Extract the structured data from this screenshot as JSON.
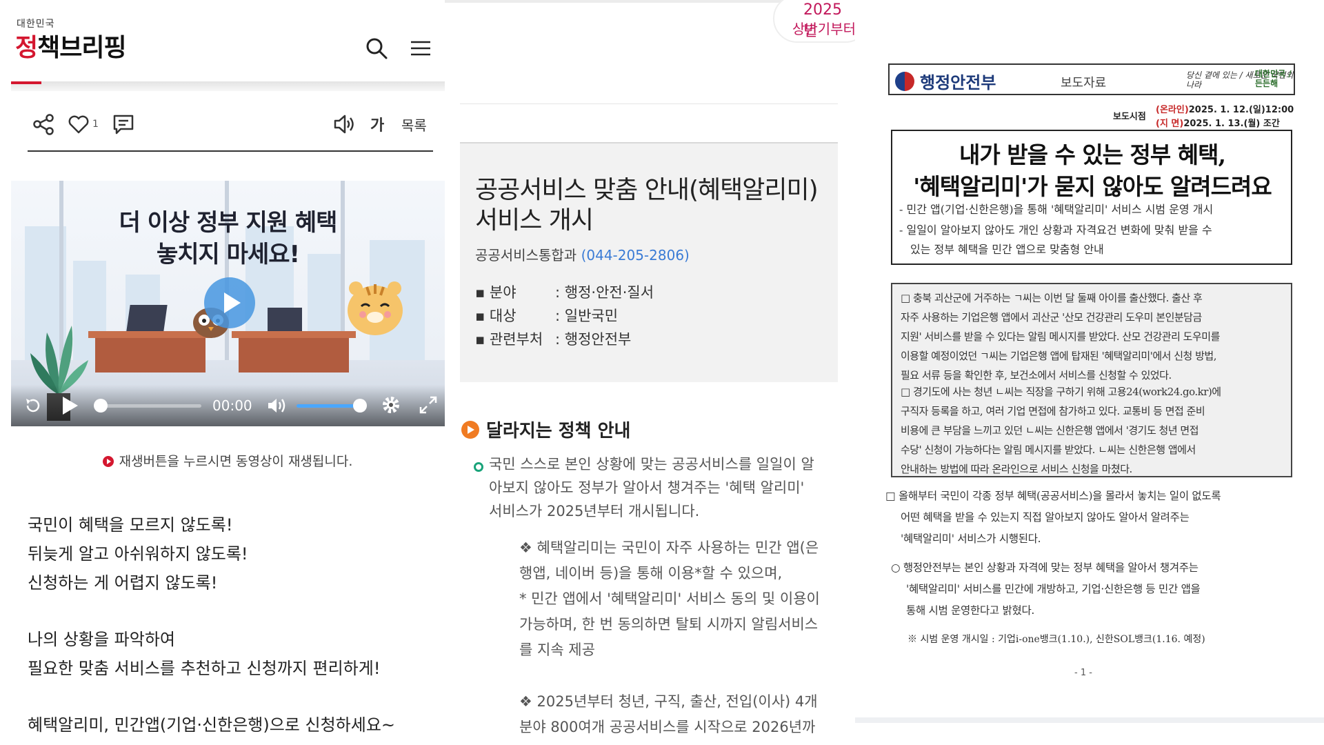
{
  "left": {
    "logo_small": "대한민국",
    "logo_red": "정",
    "logo_rest": "책브리핑",
    "likes": "1",
    "font_label": "가",
    "list_label": "목록",
    "video": {
      "title_line1": "더 이상 정부 지원 혜택",
      "title_line2": "놓치지 마세요!",
      "time": "00:00"
    },
    "hint": "재생버튼을 누르시면 동영상이 재생됩니다.",
    "para1": [
      "국민이 혜택을 모르지 않도록!",
      "뒤늦게 알고 아쉬워하지 않도록!",
      "신청하는 게 어렵지 않도록!"
    ],
    "para2": [
      "나의 상황을 파악하여",
      "필요한 맞춤 서비스를 추천하고 신청까지 편리하게!"
    ],
    "para3": "혜택알리미, 민간앱(기업·신한은행)으로 신청하세요~"
  },
  "mid": {
    "badge_year": "2025년",
    "badge_sub": "상반기부터",
    "title": "공공서비스 맞춤 안내(혜택알리미) 서비스 개시",
    "dept": "공공서비스통합과",
    "phone": "(044-205-2806)",
    "meta": [
      {
        "k": "▪ 분야",
        "v": ": 행정·안전·질서"
      },
      {
        "k": "▪ 대상",
        "v": ": 일반국민"
      },
      {
        "k": "▪ 관련부처",
        "v": ": 행정안전부"
      }
    ],
    "section": "달라지는 정책 안내",
    "lead": [
      "국민 스스로 본인 상황에 맞는 공공서비스를 일일이 알",
      "아보지 않아도 정부가 알아서 챙겨주는 '혜택 알리미'",
      "서비스가 2025년부터 개시됩니다."
    ],
    "note1": [
      "❖ 혜택알리미는 국민이 자주 사용하는 민간 앱(은",
      "행앱, 네이버 등)을 통해 이용*할 수 있으며,"
    ],
    "note2": [
      "* 민간 앱에서 '혜택알리미' 서비스 동의 및 이용이",
      "가능하며, 한 번 동의하면 탈퇴 시까지 알림서비스",
      "를 지속 제공"
    ],
    "note3": [
      "❖ 2025년부터 청년, 구직, 출산, 전입(이사) 4개",
      "분야 800여개 공공서비스를 시작으로 2026년까"
    ]
  },
  "right": {
    "ministry": "행정안전부",
    "press": "보도자료",
    "sign1": "당신 곁에 있는 / 새로운 국민의 나라",
    "sign2": "대한민국 / 든든해",
    "release_label": "보도시점",
    "release_online_tag": "(온라인)",
    "release_online": "2025. 1. 12.(일)12:00",
    "release_paper_tag": "(지 면)",
    "release_paper": "2025. 1. 13.(월) 조간",
    "title1": "내가 받을 수 있는 정부 혜택,",
    "title2": "'혜택알리미'가 묻지 않아도 알려드려요",
    "sub1": "- 민간 앱(기업·신한은행)을 통해 '혜택알리미' 서비스 시범 운영 개시",
    "sub2": "- 일일이 알아보지 않아도 개인 상황과 자격요건 변화에 맞춰 받을 수",
    "sub3": "있는 정부 혜택을 민간 앱으로 맞춤형 안내",
    "case1": [
      "□ 충북 괴산군에 거주하는 ㄱ씨는 이번 달 둘째 아이를 출산했다. 출산 후",
      "자주 사용하는 기업은행 앱에서 괴산군 '산모 건강관리 도우미 본인분담금",
      "지원' 서비스를 받을 수 있다는 알림 메시지를 받았다. 산모 건강관리 도우미를",
      "이용할 예정이었던 ㄱ씨는 기업은행 앱에 탑재된 '혜택알리미'에서 신청 방법,",
      "필요 서류 등을 확인한 후, 보건소에서 서비스를 신청할 수 있었다."
    ],
    "case2": [
      "□ 경기도에 사는 청년 ㄴ씨는 직장을 구하기 위해 고용24(work24.go.kr)에",
      "구직자 등록을 하고, 여러 기업 면접에 참가하고 있다. 교통비 등 면접 준비",
      "비용에 큰 부담을 느끼고 있던 ㄴ씨는 신한은행 앱에서 '경기도 청년 면접",
      "수당' 신청이 가능하다는 알림 메시지를 받았다. ㄴ씨는 신한은행 앱에서",
      "안내하는 방법에 따라 온라인으로 서비스 신청을 마쳤다."
    ],
    "body1": [
      "□ 올해부터 국민이 각종 정부 혜택(공공서비스)을 몰라서 놓치는 일이 없도록",
      "어떤 혜택을 받을 수 있는지 직접 알아보지 않아도 알아서 알려주는",
      "'혜택알리미' 서비스가 시행된다."
    ],
    "body2": [
      "○ 행정안전부는 본인 상황과 자격에 맞는 정부 혜택을 알아서 챙겨주는",
      "'혜택알리미' 서비스를 민간에 개방하고, 기업·신한은행 등 민간 앱을",
      "통해 시범 운영한다고 밝혔다."
    ],
    "note": "※ 시범 운영 개시일 : 기업i-one뱅크(1.10.), 신한SOL뱅크(1.16. 예정)",
    "page": "- 1 -"
  }
}
